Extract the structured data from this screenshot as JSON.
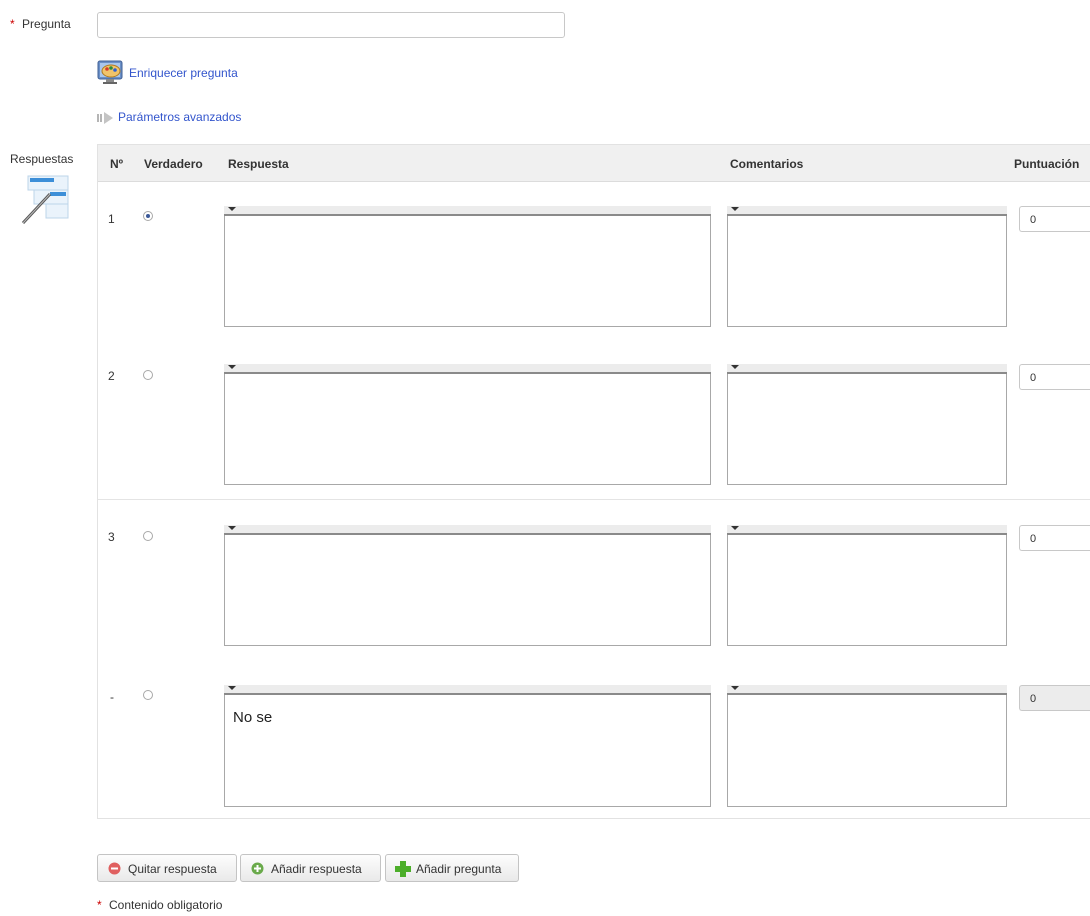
{
  "form": {
    "pregunta_label": "Pregunta",
    "required_star": "*",
    "pregunta_value": "",
    "enrich_link": "Enriquecer pregunta",
    "advanced_link": "Parámetros avanzados",
    "respuestas_label": "Respuestas"
  },
  "table": {
    "headers": [
      "Nº",
      "Verdadero",
      "Respuesta",
      "Comentarios",
      "Puntuación"
    ],
    "rows": [
      {
        "num": "1",
        "checked": true,
        "answer": "",
        "comment": "",
        "score": "0"
      },
      {
        "num": "2",
        "checked": false,
        "answer": "",
        "comment": "",
        "score": "0"
      },
      {
        "num": "3",
        "checked": false,
        "answer": "",
        "comment": "",
        "score": "0"
      },
      {
        "num": "-",
        "checked": false,
        "answer": "No se",
        "comment": "",
        "score": "0",
        "score_disabled": true
      }
    ]
  },
  "buttons": {
    "remove": "Quitar respuesta",
    "add_answer": "Añadir respuesta",
    "add_question": "Añadir pregunta"
  },
  "footer": {
    "required_note": "Contenido obligatorio"
  },
  "colors": {
    "link": "#3355cc",
    "required": "#cc0000",
    "header_bg": "#f0f0f0"
  }
}
